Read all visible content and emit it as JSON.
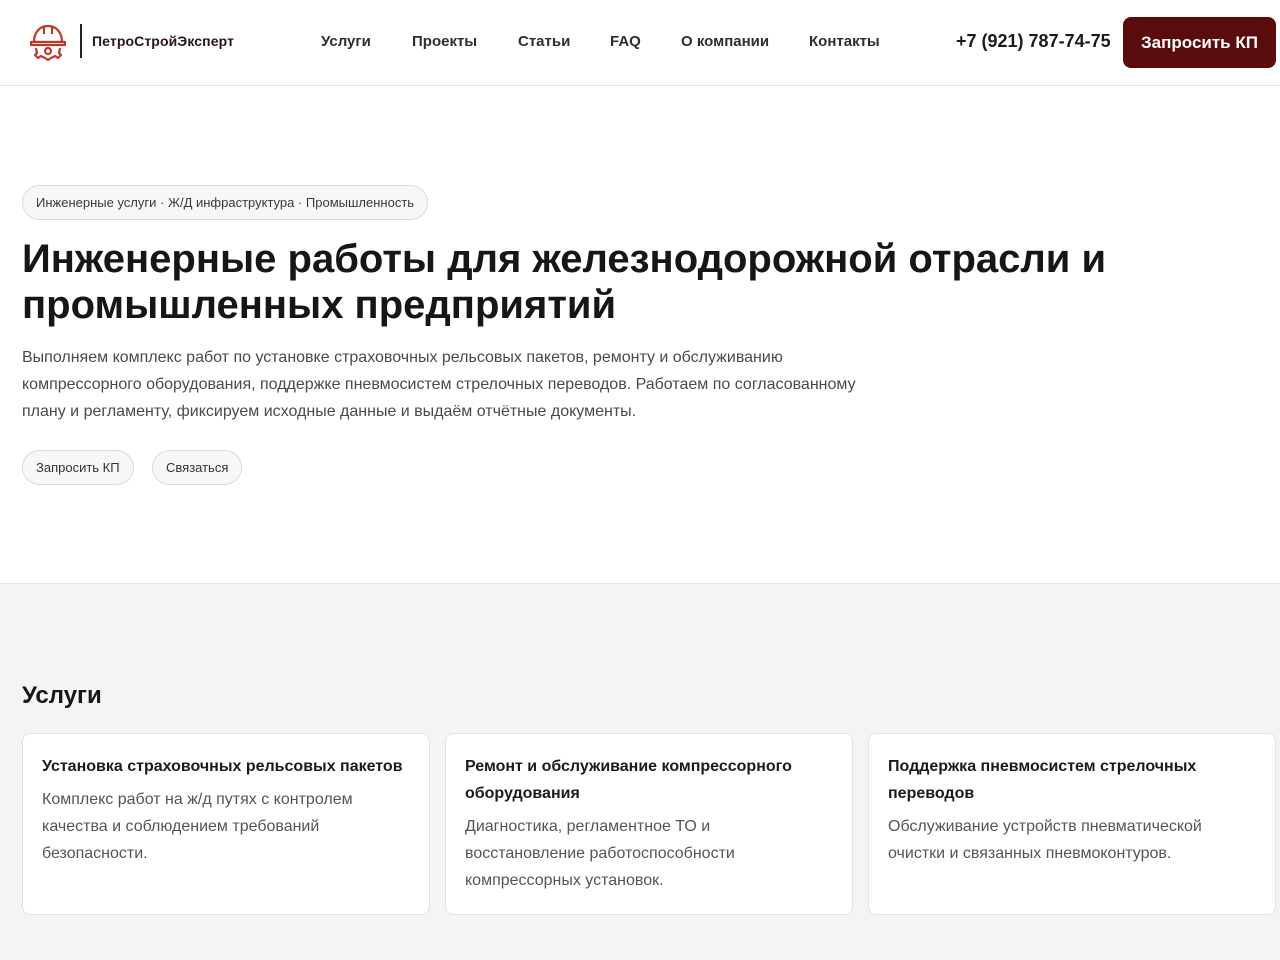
{
  "header": {
    "logo_text": "ПетроСтройЭксперт",
    "logo_icon": "hardhat-gear-icon",
    "nav": [
      {
        "label": "Услуги"
      },
      {
        "label": "Проекты"
      },
      {
        "label": "Статьи"
      },
      {
        "label": "FAQ"
      },
      {
        "label": "О компании"
      },
      {
        "label": "Контакты"
      }
    ],
    "phone": "+7 (921) 787-74-75",
    "cta_label": "Запросить КП"
  },
  "hero": {
    "tag": "Инженерные услуги · Ж/Д инфраструктура · Промышленность",
    "title": "Инженерные работы для железнодорожной отрасли и промышленных предприятий",
    "text": "Выполняем комплекс работ по установке страховочных рельсовых пакетов, ремонту и обслуживанию компрессорного оборудования, поддержке пневмосистем стрелочных переводов. Работаем по согласованному плану и регламенту, фиксируем исходные данные и выдаём отчётные документы.",
    "buttons": [
      {
        "label": "Запросить КП"
      },
      {
        "label": "Связаться"
      }
    ]
  },
  "services": {
    "title": "Услуги",
    "cards": [
      {
        "title": "Установка страховочных рельсовых пакетов",
        "text": "Комплекс работ на ж/д путях с контролем качества и соблюдением требований безопасности."
      },
      {
        "title": "Ремонт и обслуживание компрессорного оборудования",
        "text": "Диагностика, регламентное ТО и восстановление работоспособности компрессорных установок."
      },
      {
        "title": "Поддержка пневмосистем стрелочных переводов",
        "text": "Обслуживание устройств пневматической очистки и связанных пневмоконтуров."
      }
    ]
  },
  "colors": {
    "brand": "#5a0b0b",
    "logo_accent": "#c0392b"
  }
}
